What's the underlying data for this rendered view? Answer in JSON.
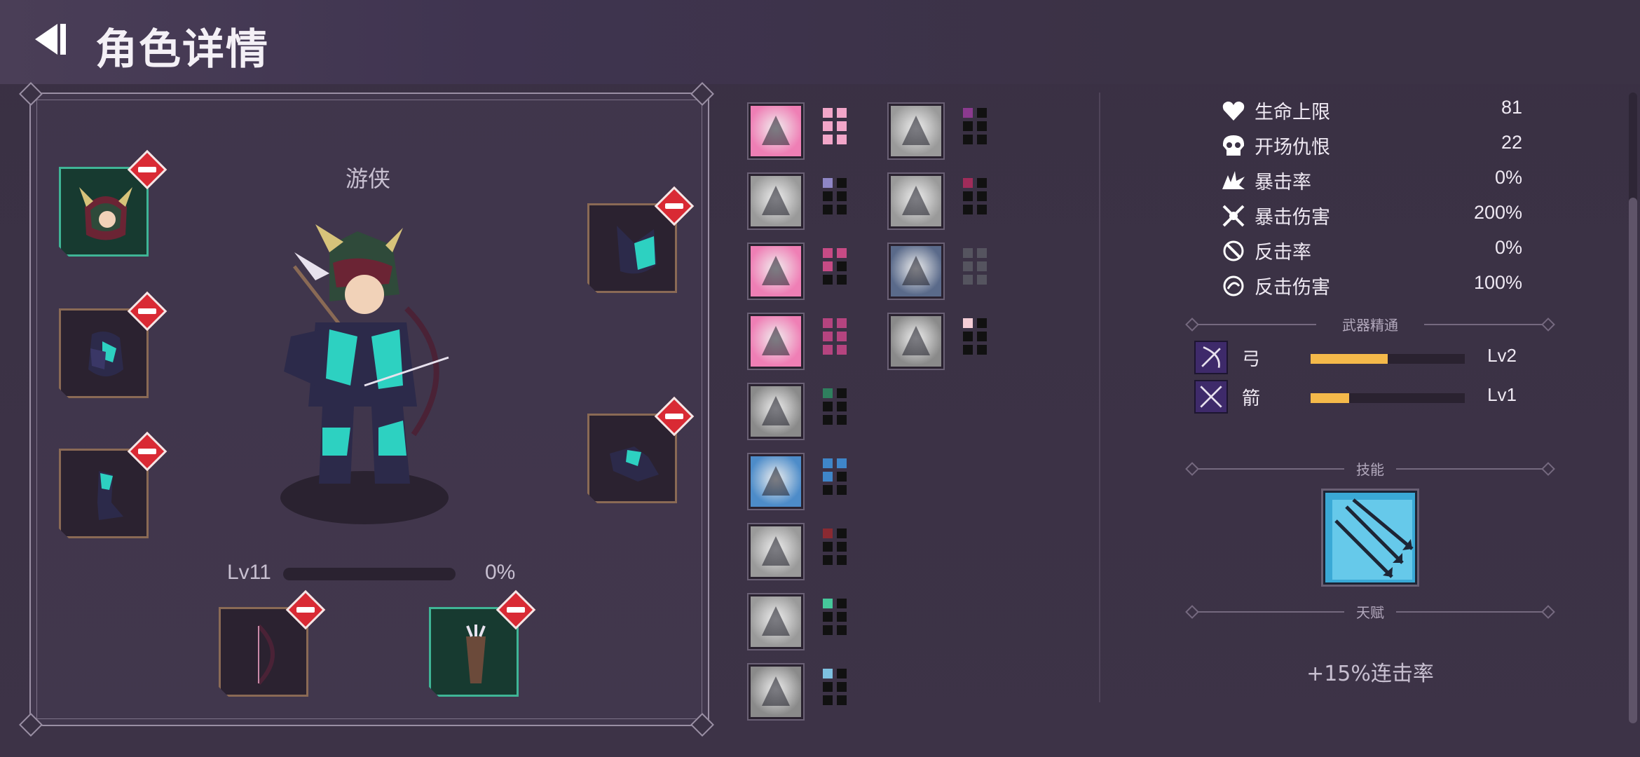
{
  "header": {
    "title": "角色详情",
    "back_icon": "back-arrow-icon"
  },
  "character": {
    "class_name": "游侠",
    "level_label": "Lv11",
    "xp_progress_label": "0%",
    "xp_progress": 0.0
  },
  "equipment_slots": [
    {
      "name": "helmet",
      "icon": "horned-helmet-icon",
      "highlight": "green"
    },
    {
      "name": "chest",
      "icon": "chest-armor-icon",
      "highlight": "brown"
    },
    {
      "name": "boots",
      "icon": "boots-icon",
      "highlight": "brown"
    },
    {
      "name": "cape",
      "icon": "hood-icon",
      "highlight": "brown"
    },
    {
      "name": "gloves",
      "icon": "gauntlet-icon",
      "highlight": "brown"
    },
    {
      "name": "bow",
      "icon": "bow-icon",
      "highlight": "brown"
    },
    {
      "name": "quiver",
      "icon": "quiver-icon",
      "highlight": "green"
    }
  ],
  "relics": [
    {
      "icon": "boot-kick-relic-icon",
      "color": "#ef7fb5",
      "pip_color": "#f2a6c9",
      "pips": 6
    },
    {
      "icon": "knight-relic-icon",
      "color": "#9a9a9a",
      "pip_color": "#8f86c6",
      "pips": 1
    },
    {
      "icon": "claw-slash-relic-icon",
      "color": "#ef7fb5",
      "pip_color": "#c74b85",
      "pips": 3
    },
    {
      "icon": "cross-swords-relic-icon",
      "color": "#ef7fb5",
      "pip_color": "#b5447f",
      "pips": 6
    },
    {
      "icon": "hooded-figure-relic-icon",
      "color": "#8a8a8a",
      "pip_color": "#2f7f5e",
      "pips": 1
    },
    {
      "icon": "viking-relic-icon",
      "color": "#4d8cc9",
      "pip_color": "#3f86c9",
      "pips": 3
    },
    {
      "icon": "dagger-relic-icon",
      "color": "#9a9a9a",
      "pip_color": "#8a2a32",
      "pips": 1
    },
    {
      "icon": "angry-face-relic-icon",
      "color": "#9a9a9a",
      "pip_color": "#46c89b",
      "pips": 1
    },
    {
      "icon": "goblin-relic-icon",
      "color": "#8a8a8a",
      "pip_color": "#7ec1e0",
      "pips": 1
    },
    {
      "icon": "stone-face-relic-icon",
      "color": "#9a9a9a",
      "pip_color": "#8b3a8f",
      "pips": 1
    },
    {
      "icon": "tower-relic-icon",
      "color": "#9a9a9a",
      "pip_color": "#a02c5a",
      "pips": 1
    },
    {
      "icon": "night-orb-relic-icon",
      "color": "#5a6a8a",
      "pip_color": "#55545f",
      "pips": 6
    },
    {
      "icon": "crossed-scimitars-relic-icon",
      "color": "#8a8a8a",
      "pip_color": "#f4cdd6",
      "pips": 1
    }
  ],
  "stats": [
    {
      "icon": "heart-icon",
      "label": "生命上限",
      "value": "81"
    },
    {
      "icon": "skull-icon",
      "label": "开场仇恨",
      "value": "22"
    },
    {
      "icon": "crit-burst-icon",
      "label": "暴击率",
      "value": "0%"
    },
    {
      "icon": "crit-damage-icon",
      "label": "暴击伤害",
      "value": "200%"
    },
    {
      "icon": "counter-icon",
      "label": "反击率",
      "value": "0%"
    },
    {
      "icon": "counter-damage-icon",
      "label": "反击伤害",
      "value": "100%"
    }
  ],
  "weapon_mastery": {
    "title": "武器精通",
    "items": [
      {
        "icon": "bow-mastery-icon",
        "name": "弓",
        "level": "Lv2",
        "progress": 0.5
      },
      {
        "icon": "arrow-mastery-icon",
        "name": "箭",
        "level": "Lv1",
        "progress": 0.25
      }
    ]
  },
  "skill": {
    "title": "技能",
    "icon": "multi-arrow-skill-icon"
  },
  "talent": {
    "title": "天赋",
    "text": "+15%连击率"
  },
  "colors": {
    "background": "#3b3245",
    "accent_gold": "#f4b94a",
    "remove_red": "#d92a34"
  }
}
